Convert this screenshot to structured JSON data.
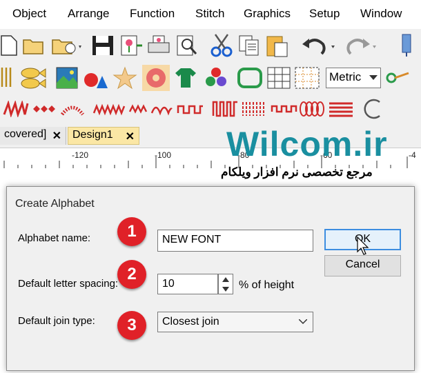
{
  "menu": {
    "items": [
      "Object",
      "Arrange",
      "Function",
      "Stitch",
      "Graphics",
      "Setup",
      "Window"
    ]
  },
  "toolbar": {
    "units_select": "Metric"
  },
  "tabs": {
    "recovered_label": "covered]",
    "design_label": "Design1",
    "close_glyph": "✕"
  },
  "ruler": {
    "labels": [
      "-120",
      "-100",
      "-80",
      "-60",
      "-4"
    ]
  },
  "watermark": {
    "title": "Wilcom.ir",
    "subtitle": "مرجع تخصصی نرم افزار ویلکام"
  },
  "dialog": {
    "title": "Create Alphabet",
    "alphabet_name_label": "Alphabet name:",
    "alphabet_name_value": "NEW FONT",
    "letter_spacing_label": "Default letter spacing:",
    "letter_spacing_value": "10",
    "letter_spacing_unit": "% of height",
    "join_type_label": "Default join type:",
    "join_type_value": "Closest join",
    "ok_label": "OK",
    "cancel_label": "Cancel"
  },
  "annotations": [
    "1",
    "2",
    "3"
  ],
  "colors": {
    "badge": "#e02128",
    "watermark": "#1a8fa0",
    "tab_active": "#fbe7a5",
    "focus": "#3c8de0"
  }
}
